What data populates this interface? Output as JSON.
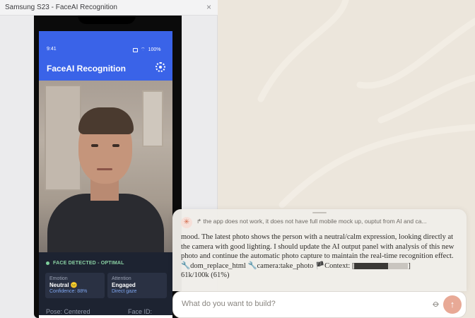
{
  "window": {
    "title": "Samsung S23 - FaceAI Recognition",
    "close_icon": "×"
  },
  "phone": {
    "status_time": "9:41",
    "battery": "100%",
    "app_title": "FaceAI Recognition",
    "icons": [
      "sim-icon",
      "wifi-icon",
      "battery-icon",
      "gear-icon"
    ]
  },
  "analysis": {
    "status": "FACE DETECTED - OPTIMAL",
    "emotion_label": "Emotion",
    "emotion_value": "Neutral 😐",
    "emotion_sub": "Confidence: 88%",
    "attention_label": "Attention",
    "attention_value": "Engaged",
    "attention_sub": "Direct gaze",
    "pose": "Pose: Centered",
    "face_id": "Face ID:"
  },
  "chat": {
    "header": "↱ the app does not work, it does not have full mobile mock up, ouptut from AI and ca...",
    "body": "mood. The latest photo shows the person with a neutral/calm expression, looking directly at the camera with good lighting. I should update the AI output panel with analysis of this new photo and continue the automatic photo capture to maintain the real-time recognition effect.",
    "tool1": "dom_replace_html",
    "tool2": "camera:take_photo",
    "context_label": "Context: [",
    "context_end": "]",
    "context_value": "61k/100k (61%)",
    "input_placeholder": "What do you want to build?",
    "colors": {
      "accent": "#e8a996",
      "phone_header": "#3a63e8",
      "panel_bg": "#1d2331",
      "detected": "#8ad1a3"
    }
  }
}
